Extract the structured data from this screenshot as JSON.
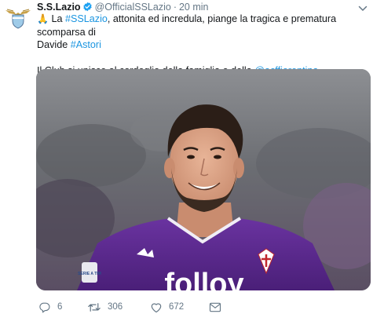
{
  "tweet": {
    "author_name": "S.S.Lazio",
    "handle": "@OfficialSSLazio",
    "separator": "·",
    "time": "20 min",
    "verified": true,
    "text": {
      "emoji": "🙏",
      "line1_a": " La ",
      "hashtag1": "#SSLazio",
      "line1_b": ", attonita ed incredula, piange la tragica e prematura scomparsa di",
      "line2_a": "Davide ",
      "hashtag2": "#Astori",
      "line3_a": "Il Club si unisce al cordoglio della famiglia e della ",
      "mention": "@acffiorentina"
    },
    "media": {
      "jersey_sponsor_text": "folloy",
      "badge_text": "SERIE A TIM"
    },
    "actions": {
      "reply_count": "6",
      "retweet_count": "306",
      "like_count": "672"
    }
  },
  "colors": {
    "link": "#1b95e0",
    "secondary_text": "#657786",
    "verified": "#1da1f2",
    "jersey_purple": "#5b2a86"
  },
  "icons": {
    "avatar": "lazio-eagle-logo",
    "verified": "verified-badge-icon",
    "caret": "chevron-down-icon",
    "reply": "reply-icon",
    "retweet": "retweet-icon",
    "like": "heart-icon",
    "message": "envelope-icon"
  }
}
